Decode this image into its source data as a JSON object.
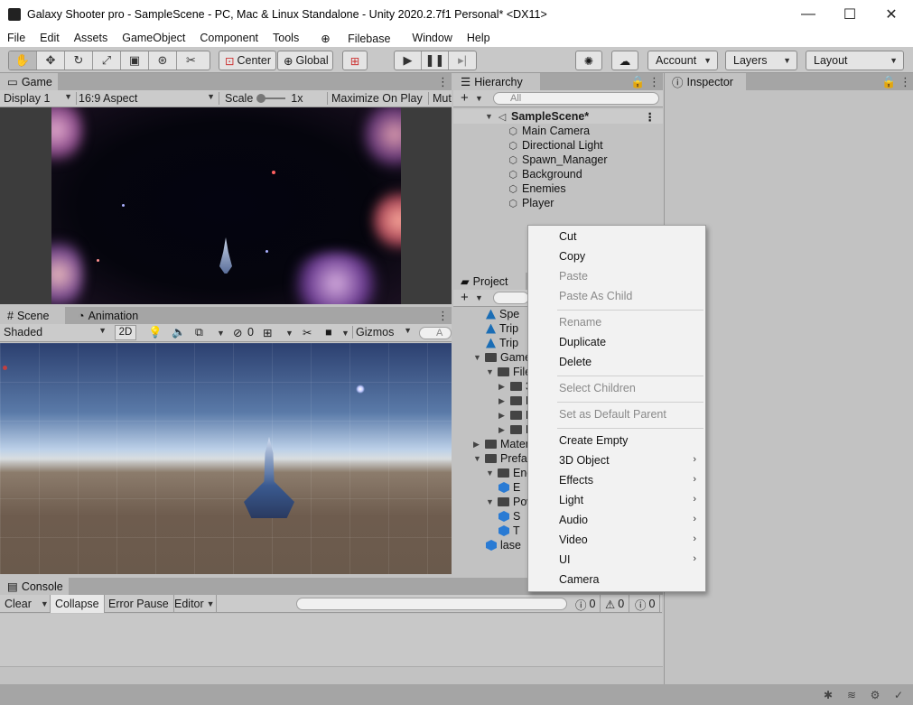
{
  "window": {
    "title": "Galaxy Shooter pro - SampleScene - PC, Mac & Linux Standalone - Unity 2020.2.7f1 Personal* <DX11>",
    "minimize": "—",
    "maximize": "☐",
    "close": "✕"
  },
  "menu": [
    "File",
    "Edit",
    "Assets",
    "GameObject",
    "Component",
    "Tools",
    "Filebase",
    "Window",
    "Help"
  ],
  "toolbar": {
    "pivot_label": "Center",
    "space_label": "Global",
    "account_label": "Account",
    "layers_label": "Layers",
    "layout_label": "Layout"
  },
  "game": {
    "tab_label": "Game",
    "display": "Display 1",
    "aspect": "16:9 Aspect",
    "scale_label": "Scale",
    "scale_value": "1x",
    "maximize_label": "Maximize On Play",
    "mute_label": "Mut"
  },
  "scene": {
    "tab_label": "Scene",
    "animation_tab_label": "Animation",
    "shading": "Shaded",
    "mode_2d": "2D",
    "hidden_count": "0",
    "gizmos_label": "Gizmos",
    "search_placeholder": "A"
  },
  "hierarchy": {
    "tab_label": "Hierarchy",
    "search_placeholder": "All",
    "scene_name": "SampleScene*",
    "items": [
      "Main Camera",
      "Directional Light",
      "Spawn_Manager",
      "Background",
      "Enemies",
      "Player"
    ]
  },
  "project": {
    "tab_label": "Project",
    "rows": [
      {
        "label": "Spe",
        "type": "sprite",
        "indent": 2
      },
      {
        "label": "Trip",
        "type": "sprite",
        "indent": 2
      },
      {
        "label": "Trip",
        "type": "sprite",
        "indent": 2
      },
      {
        "label": "Game",
        "type": "folder-open",
        "indent": 1
      },
      {
        "label": "File",
        "type": "folder-open",
        "indent": 2
      },
      {
        "label": "3",
        "type": "folder",
        "indent": 3
      },
      {
        "label": "E",
        "type": "folder",
        "indent": 3
      },
      {
        "label": "P",
        "type": "folder",
        "indent": 3
      },
      {
        "label": "P",
        "type": "folder",
        "indent": 3
      },
      {
        "label": "Mater",
        "type": "folder",
        "indent": 1
      },
      {
        "label": "Prefab",
        "type": "folder-open",
        "indent": 1
      },
      {
        "label": "Ene",
        "type": "folder-open",
        "indent": 2
      },
      {
        "label": "E",
        "type": "prefab",
        "indent": 3
      },
      {
        "label": "Pow",
        "type": "folder-open",
        "indent": 2
      },
      {
        "label": "S",
        "type": "prefab",
        "indent": 3
      },
      {
        "label": "T",
        "type": "prefab",
        "indent": 3
      },
      {
        "label": "lase",
        "type": "prefab",
        "indent": 2
      }
    ]
  },
  "inspector": {
    "tab_label": "Inspector"
  },
  "console": {
    "tab_label": "Console",
    "clear_label": "Clear",
    "collapse_label": "Collapse",
    "error_pause_label": "Error Pause",
    "editor_label": "Editor",
    "log_count": "0",
    "warn_count": "0",
    "error_count": "0"
  },
  "context_menu": {
    "items": [
      {
        "label": "Cut",
        "enabled": true
      },
      {
        "label": "Copy",
        "enabled": true
      },
      {
        "label": "Paste",
        "enabled": false
      },
      {
        "label": "Paste As Child",
        "enabled": false
      },
      {
        "label": "Rename",
        "enabled": false
      },
      {
        "label": "Duplicate",
        "enabled": true
      },
      {
        "label": "Delete",
        "enabled": true
      },
      {
        "label": "Select Children",
        "enabled": false
      },
      {
        "label": "Set as Default Parent",
        "enabled": false
      },
      {
        "label": "Create Empty",
        "enabled": true
      },
      {
        "label": "3D Object",
        "enabled": true,
        "submenu": true
      },
      {
        "label": "Effects",
        "enabled": true,
        "submenu": true
      },
      {
        "label": "Light",
        "enabled": true,
        "submenu": true
      },
      {
        "label": "Audio",
        "enabled": true,
        "submenu": true
      },
      {
        "label": "Video",
        "enabled": true,
        "submenu": true
      },
      {
        "label": "UI",
        "enabled": true,
        "submenu": true
      },
      {
        "label": "Camera",
        "enabled": true
      }
    ]
  },
  "colors": {
    "panel_bg": "#c2c2c2",
    "tabstrip_bg": "#a5a5a5",
    "prefab_blue": "#2a7bd4"
  }
}
